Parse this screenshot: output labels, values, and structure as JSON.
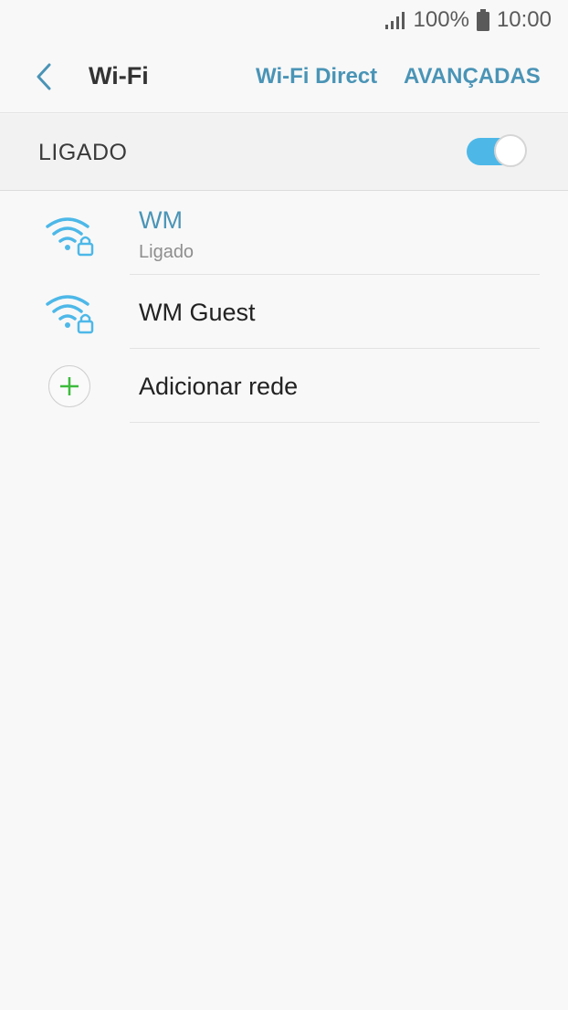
{
  "status_bar": {
    "signal_icon": "signal-icon",
    "battery_percent": "100%",
    "battery_icon": "battery-icon",
    "time": "10:00"
  },
  "header": {
    "back_icon": "chevron-left-icon",
    "title": "Wi-Fi",
    "action_direct": "Wi-Fi Direct",
    "action_advanced": "AVANÇADAS"
  },
  "master_switch": {
    "label": "LIGADO",
    "state": "on"
  },
  "networks": [
    {
      "name": "WM",
      "status": "Ligado",
      "icon": "wifi-lock-icon",
      "connected": true
    },
    {
      "name": "WM Guest",
      "icon": "wifi-lock-icon",
      "connected": false
    }
  ],
  "add_network": {
    "label": "Adicionar rede",
    "icon": "plus-icon"
  },
  "colors": {
    "accent": "#4a94b6",
    "toggle_on": "#4db8e8",
    "plus": "#3dbb3d",
    "background": "#f8f8f8"
  }
}
